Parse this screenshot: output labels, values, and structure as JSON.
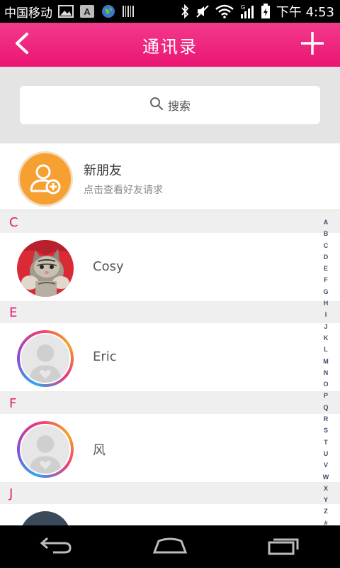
{
  "status_bar": {
    "carrier": "中国移动",
    "time": "下午 4:53",
    "icons": [
      "image-icon",
      "a-keyboard-icon",
      "globe-icon",
      "barcode-icon",
      "bluetooth-icon",
      "mute-icon",
      "wifi-icon",
      "signal-icon",
      "battery-icon"
    ]
  },
  "header": {
    "title": "通讯录",
    "back_icon": "back-chevron-icon",
    "add_icon": "plus-icon",
    "color": "#ea1573"
  },
  "search": {
    "placeholder": "搜索"
  },
  "new_friend": {
    "title": "新朋友",
    "subtitle": "点击查看好友请求",
    "icon_color": "#f5a030"
  },
  "sections": [
    {
      "letter": "C",
      "contacts": [
        {
          "name": "Cosy",
          "avatar": "cat-photo"
        }
      ]
    },
    {
      "letter": "E",
      "contacts": [
        {
          "name": "Eric",
          "avatar": "default-avatar"
        }
      ]
    },
    {
      "letter": "F",
      "contacts": [
        {
          "name": "风",
          "avatar": "default-avatar"
        }
      ]
    },
    {
      "letter": "J",
      "contacts": []
    }
  ],
  "alphabet": [
    "A",
    "B",
    "C",
    "D",
    "E",
    "F",
    "G",
    "H",
    "I",
    "J",
    "K",
    "L",
    "M",
    "N",
    "O",
    "P",
    "Q",
    "R",
    "S",
    "T",
    "U",
    "V",
    "W",
    "X",
    "Y",
    "Z",
    "#"
  ],
  "accent_color": "#e61a6e",
  "nav_bar": [
    "back-arrow-icon",
    "home-icon",
    "recent-apps-icon"
  ]
}
